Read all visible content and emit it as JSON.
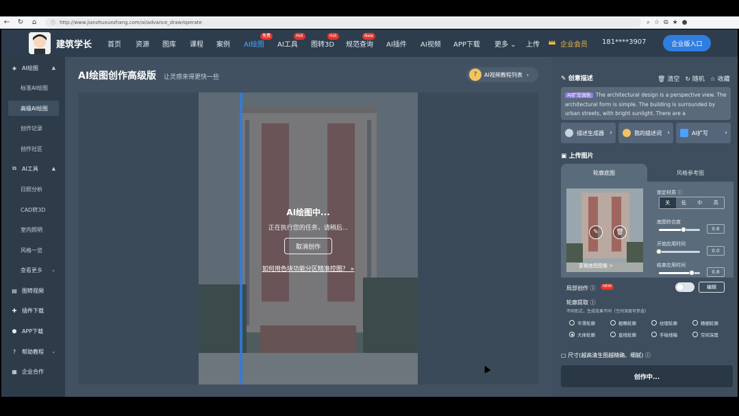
{
  "browser": {
    "url": "http://www.jianzhuxuezhang.com/ai/advance_draw/operate"
  },
  "header": {
    "logo_text": "建筑学长",
    "nav": [
      {
        "label": "首页",
        "badge": ""
      },
      {
        "label": "资源",
        "badge": ""
      },
      {
        "label": "图库",
        "badge": ""
      },
      {
        "label": "课程",
        "badge": ""
      },
      {
        "label": "案例",
        "badge": ""
      },
      {
        "label": "AI绘图",
        "badge": "免费"
      },
      {
        "label": "AI工具",
        "badge": "Hot"
      },
      {
        "label": "图转3D",
        "badge": "Hot"
      },
      {
        "label": "规范查询",
        "badge": "New"
      },
      {
        "label": "AI插件",
        "badge": ""
      },
      {
        "label": "AI视频",
        "badge": ""
      },
      {
        "label": "APP下载",
        "badge": ""
      },
      {
        "label": "更多",
        "badge": ""
      },
      {
        "label": "上传",
        "badge": ""
      }
    ],
    "member": "企业会员",
    "phone": "181****3907",
    "enterprise_btn": "企业版入口"
  },
  "sidebar": {
    "items": [
      {
        "label": "AI绘图",
        "type": "section",
        "caret": "▲"
      },
      {
        "label": "标准AI绘图",
        "type": "sub"
      },
      {
        "label": "高级AI绘图",
        "type": "active"
      },
      {
        "label": "创作记录",
        "type": "sub"
      },
      {
        "label": "创作社区",
        "type": "sub"
      },
      {
        "label": "AI工具",
        "type": "section",
        "caret": "▲"
      },
      {
        "label": "日照分析",
        "type": "sub"
      },
      {
        "label": "CAD转3D",
        "type": "sub"
      },
      {
        "label": "室内照明",
        "type": "sub"
      },
      {
        "label": "风格一览",
        "type": "sub"
      },
      {
        "label": "查看更多",
        "type": "sub",
        "caret": "⌄"
      },
      {
        "label": "图转视频",
        "type": "section"
      },
      {
        "label": "插件下载",
        "type": "section"
      },
      {
        "label": "APP下载",
        "type": "section"
      },
      {
        "label": "帮助教程",
        "type": "section",
        "caret": "⌄"
      },
      {
        "label": "企业合作",
        "type": "section"
      }
    ]
  },
  "main": {
    "title": "AI绘图创作高级版",
    "subtitle": "让灵感来得更快一些",
    "tutorial_btn": "AI视频教程列表",
    "overlay": {
      "title": "AI绘图中...",
      "message": "正在执行您的任务，请稍后...",
      "cancel": "取消创作",
      "help_link": "如何用色块功能分区精准控图？ »"
    }
  },
  "right_panel": {
    "creative_desc_label": "创意描述",
    "actions": [
      "清空",
      "随机",
      "收藏"
    ],
    "desc_tag": "AI扩写润色",
    "desc_text": "The architectural design is a perspective view. The architectural form is simple. The building is surrounded by urban streets, with bright sunlight. There are a",
    "tools": [
      "描述生成器",
      "我的描述词",
      "AI扩写"
    ],
    "upload_label": "上传图片",
    "upload_tabs": [
      "轮廓底图",
      "风格参考图"
    ],
    "thumb_caption": "更换底图图像 >",
    "lock_material_label": "锁定材质",
    "lock_options": [
      "关",
      "低",
      "中",
      "高"
    ],
    "lock_selected": "关",
    "sliders": [
      {
        "label": "底图符合度",
        "value": "0.6",
        "fraction": 0.6
      },
      {
        "label": "开始应用时间",
        "value": "0.0",
        "fraction": 0.0
      },
      {
        "label": "结束应用时间",
        "value": "0.8",
        "fraction": 0.8
      }
    ],
    "local_creation_label": "局部创作",
    "new_badge": "NEW",
    "edit_btn": "编辑",
    "outline_label": "轮廓提取",
    "outline_hint": "不同形式，生成效果不同（空间深度可参选）",
    "outline_options": [
      "平滑轮廓",
      "粗略轮廓",
      "纹理轮廓",
      "精细轮廓",
      "大体轮廓",
      "直线轮廓",
      "手绘线稿",
      "空间深度"
    ],
    "outline_selected": "大体轮廓",
    "size_label": "尺寸(越高清生图越精确、细腻)",
    "creating_btn": "创作中..."
  }
}
